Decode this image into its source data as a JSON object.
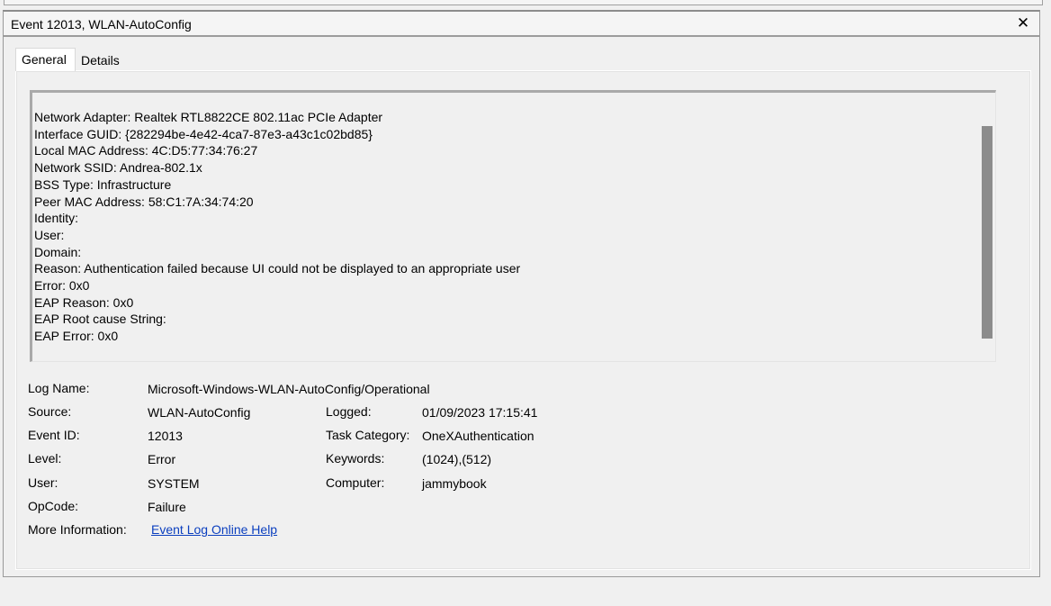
{
  "window": {
    "title": "Event 12013, WLAN-AutoConfig",
    "close_glyph": "✕"
  },
  "tabs": [
    {
      "label": "General",
      "active": true
    },
    {
      "label": "Details",
      "active": false
    }
  ],
  "description_lines": [
    "Network Adapter: Realtek RTL8822CE 802.11ac PCIe Adapter",
    "Interface GUID: {282294be-4e42-4ca7-87e3-a43c1c02bd85}",
    "Local MAC Address: 4C:D5:77:34:76:27",
    "Network SSID: Andrea-802.1x",
    "BSS Type: Infrastructure",
    "Peer MAC Address: 58:C1:7A:34:74:20",
    "Identity:",
    "User:",
    "Domain:",
    "Reason: Authentication failed because UI could not be displayed to an appropriate user",
    "Error: 0x0",
    "EAP Reason: 0x0",
    "EAP Root cause String:",
    "EAP Error: 0x0"
  ],
  "fields": {
    "log_name": {
      "label": "Log Name:",
      "value": "Microsoft-Windows-WLAN-AutoConfig/Operational"
    },
    "source": {
      "label": "Source:",
      "value": "WLAN-AutoConfig"
    },
    "event_id": {
      "label": "Event ID:",
      "value": "12013"
    },
    "level": {
      "label": "Level:",
      "value": "Error"
    },
    "user": {
      "label": "User:",
      "value": "SYSTEM"
    },
    "opcode": {
      "label": "OpCode:",
      "value": "Failure"
    },
    "more_info": {
      "label": "More Information:",
      "value": "Event Log Online Help"
    },
    "logged": {
      "label": "Logged:",
      "value": "01/09/2023 17:15:41"
    },
    "task_category": {
      "label": "Task Category:",
      "value": "OneXAuthentication"
    },
    "keywords": {
      "label": "Keywords:",
      "value": "(1024),(512)"
    },
    "computer": {
      "label": "Computer:",
      "value": "jammybook"
    }
  },
  "colors": {
    "link": "#0b3fbf",
    "scroll_thumb": "#8c8c8c"
  }
}
